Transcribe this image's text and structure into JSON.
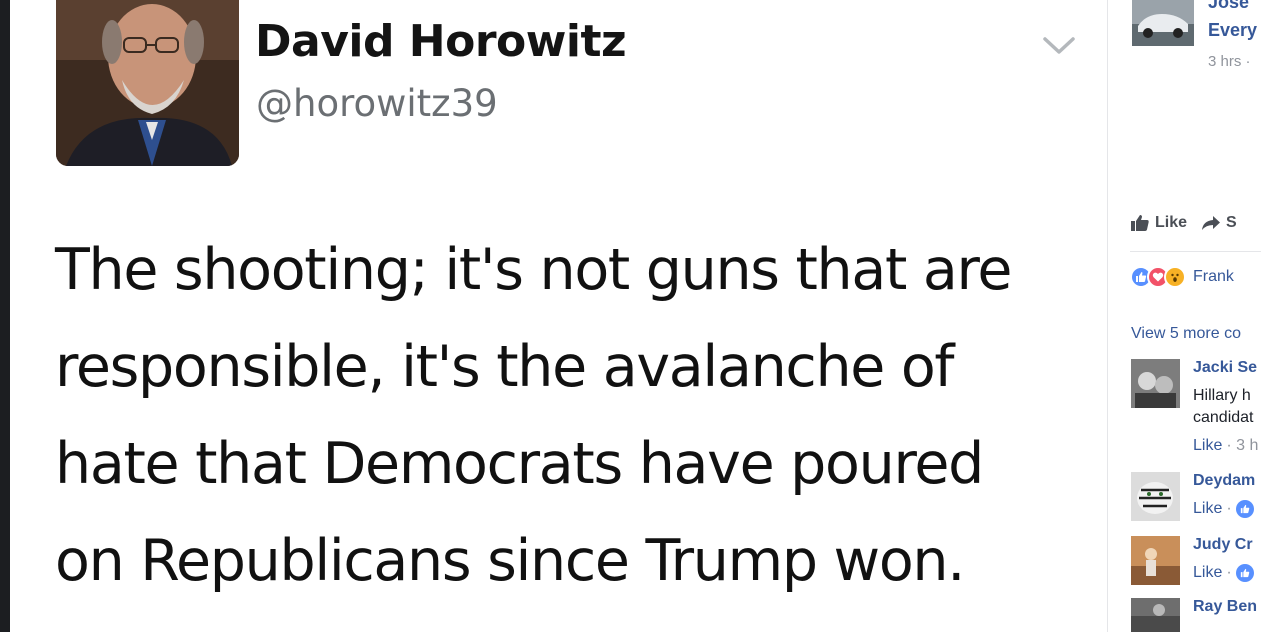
{
  "tweet": {
    "display_name": "David Horowitz",
    "handle": "@horowitz39",
    "text_lines": [
      "The shooting; it's not guns that are",
      "responsible, it's the avalanche of",
      "hate that Democrats have poured",
      "on Republicans since Trump won."
    ],
    "menu_icon": "chevron-down-icon"
  },
  "sidebar": {
    "top_post": {
      "name": "Jose",
      "subtitle": "Every",
      "time": "3 hrs ·"
    },
    "actions": {
      "like_label": "Like",
      "share_label": "S"
    },
    "reactions": {
      "icons": [
        "like-reaction-icon",
        "love-reaction-icon",
        "wow-reaction-icon"
      ],
      "names": "Frank"
    },
    "view_more": "View 5 more co",
    "comments": [
      {
        "name": "Jacki Se",
        "lines": [
          "Hillary h",
          "candidat"
        ],
        "meta_like": "Like",
        "meta_rest": "· 3 h"
      },
      {
        "name": "Deydam",
        "lines": [],
        "meta_like": "Like",
        "meta_rest": "·"
      },
      {
        "name": "Judy Cr",
        "lines": [],
        "meta_like": "Like",
        "meta_rest": "·"
      },
      {
        "name": "Ray Ben",
        "lines": [],
        "meta_like": "",
        "meta_rest": ""
      }
    ]
  },
  "colors": {
    "link_blue": "#365899",
    "meta_gray": "#90949c",
    "like_blue": "#5890ff",
    "love_red": "#f25268",
    "wow_yellow": "#f7b125"
  }
}
